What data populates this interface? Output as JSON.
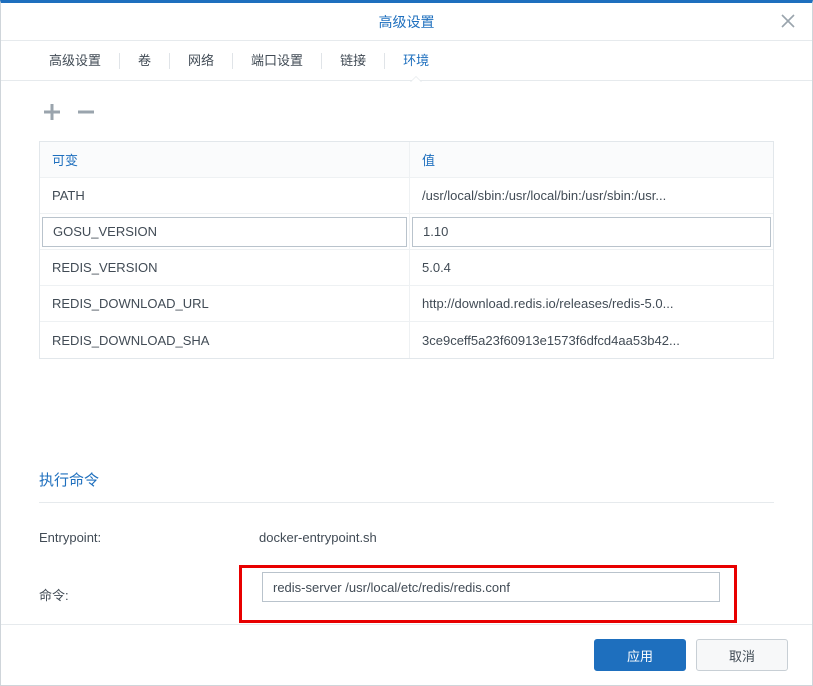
{
  "dialog": {
    "title": "高级设置"
  },
  "tabs": {
    "items": [
      {
        "label": "高级设置"
      },
      {
        "label": "卷"
      },
      {
        "label": "网络"
      },
      {
        "label": "端口设置"
      },
      {
        "label": "链接"
      },
      {
        "label": "环境"
      }
    ]
  },
  "env_table": {
    "header_key": "可变",
    "header_val": "值",
    "rows": [
      {
        "key": "PATH",
        "val": "/usr/local/sbin:/usr/local/bin:/usr/sbin:/usr..."
      },
      {
        "key": "GOSU_VERSION",
        "val": "1.10"
      },
      {
        "key": "REDIS_VERSION",
        "val": "5.0.4"
      },
      {
        "key": "REDIS_DOWNLOAD_URL",
        "val": "http://download.redis.io/releases/redis-5.0..."
      },
      {
        "key": "REDIS_DOWNLOAD_SHA",
        "val": "3ce9ceff5a23f60913e1573f6dfcd4aa53b42..."
      }
    ]
  },
  "exec": {
    "section_title": "执行命令",
    "entrypoint_label": "Entrypoint:",
    "entrypoint_value": "docker-entrypoint.sh",
    "cmd_label": "命令:",
    "cmd_value": "redis-server /usr/local/etc/redis/redis.conf"
  },
  "footer": {
    "apply": "应用",
    "cancel": "取消"
  }
}
